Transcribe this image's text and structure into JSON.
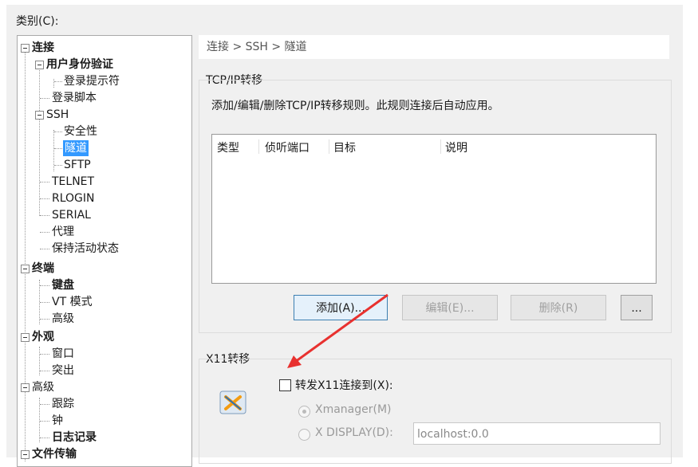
{
  "category_label": "类别(C):",
  "tree": {
    "items": [
      {
        "label": "连接"
      },
      {
        "label": "用户身份验证"
      },
      {
        "label": "登录提示符"
      },
      {
        "label": "登录脚本"
      },
      {
        "label": "SSH"
      },
      {
        "label": "安全性"
      },
      {
        "label": "隧道"
      },
      {
        "label": "SFTP"
      },
      {
        "label": "TELNET"
      },
      {
        "label": "RLOGIN"
      },
      {
        "label": "SERIAL"
      },
      {
        "label": "代理"
      },
      {
        "label": "保持活动状态"
      },
      {
        "label": "终端"
      },
      {
        "label": "键盘"
      },
      {
        "label": "VT 模式"
      },
      {
        "label": "高级"
      },
      {
        "label": "外观"
      },
      {
        "label": "窗口"
      },
      {
        "label": "突出"
      },
      {
        "label": "高级"
      },
      {
        "label": "跟踪"
      },
      {
        "label": "钟"
      },
      {
        "label": "日志记录"
      },
      {
        "label": "文件传输"
      }
    ]
  },
  "breadcrumb": "连接 > SSH > 隧道",
  "tcp": {
    "title": "TCP/IP转移",
    "description": "添加/编辑/删除TCP/IP转移规则。此规则连接后自动应用。",
    "columns": [
      "类型",
      "侦听端口",
      "目标",
      "说明"
    ],
    "buttons": {
      "add": "添加(A)...",
      "edit": "编辑(E)...",
      "delete": "删除(R)",
      "more": "..."
    }
  },
  "x11": {
    "title": "X11转移",
    "checkbox_label": "转发X11连接到(X):",
    "checkbox_checked": false,
    "option_xmanager": "Xmanager(M)",
    "option_xdisplay": "X DISPLAY(D):",
    "display_value": "localhost:0.0"
  },
  "colors": {
    "selection": "#3399ff",
    "arrow": "#e8312f"
  }
}
